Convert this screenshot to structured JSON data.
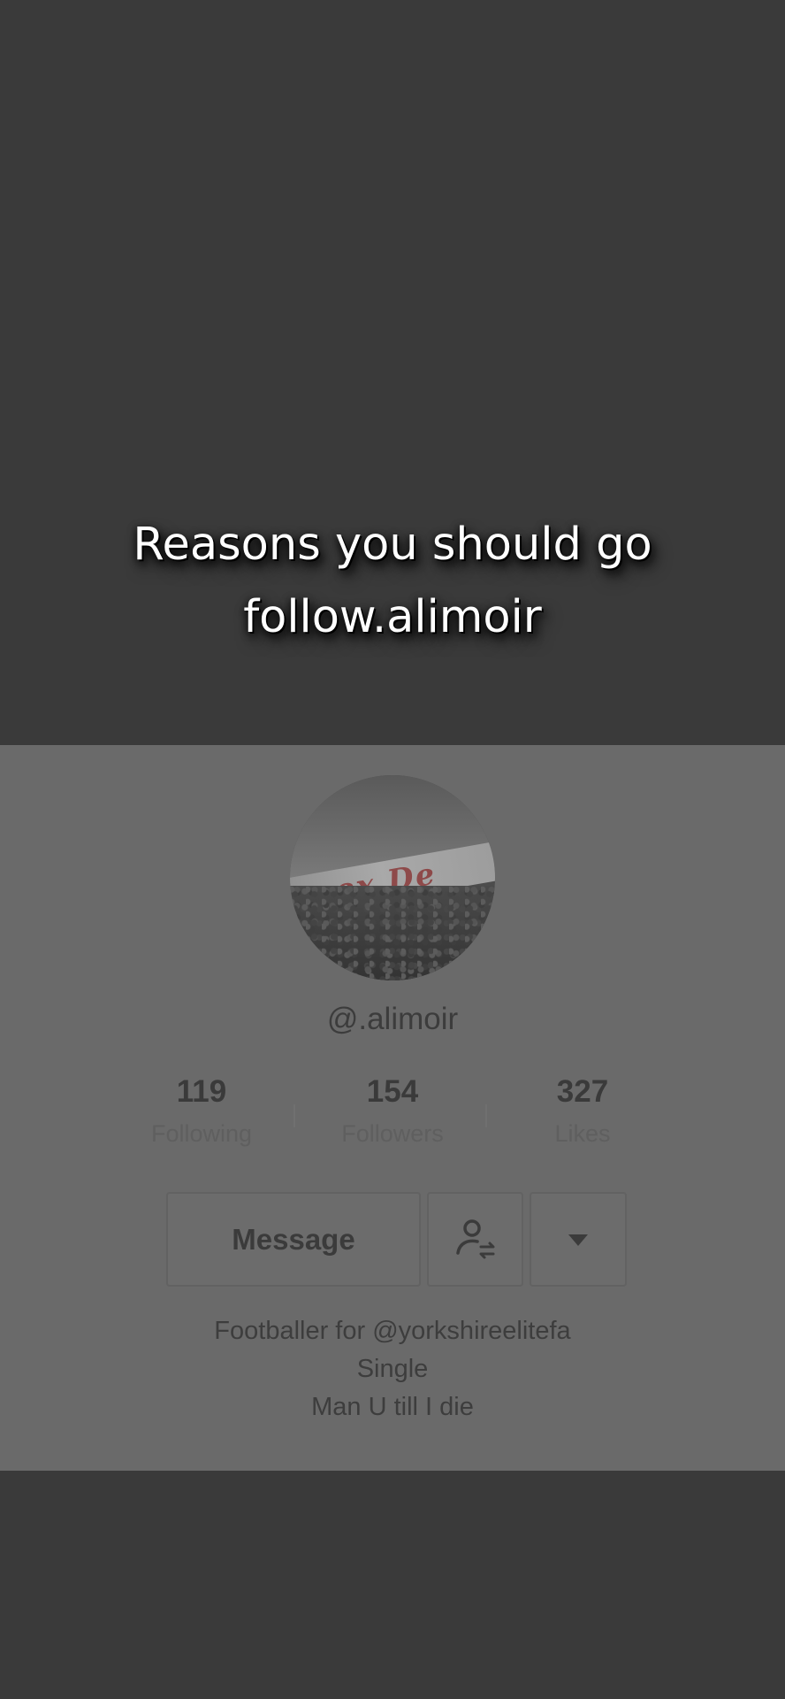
{
  "caption": {
    "line1": "Reasons you should go",
    "line2": "follow.alimoir"
  },
  "profile": {
    "avatar_icon": "profile-photo",
    "avatar_banner_text": "sex De",
    "username": "@.alimoir",
    "stats": [
      {
        "value": "119",
        "label": "Following"
      },
      {
        "value": "154",
        "label": "Followers"
      },
      {
        "value": "327",
        "label": "Likes"
      }
    ],
    "buttons": {
      "message_label": "Message",
      "follow_icon": "add-friend-swap-icon",
      "more_icon": "caret-down-icon"
    },
    "bio": [
      "Footballer for @yorkshireelitefa",
      "Single",
      "Man U till I die"
    ]
  },
  "colors": {
    "background": "#3a3a3a",
    "card": "#6a6a6a",
    "caption_text": "#ffffff"
  }
}
